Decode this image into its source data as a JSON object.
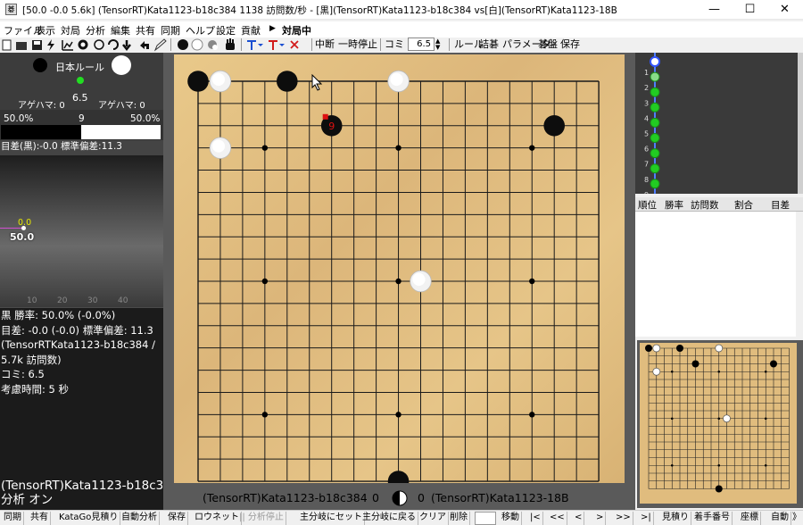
{
  "window": {
    "title": "[50.0 -0.0 5.6k] (TensorRT)Kata1123-b18c384 1138 訪問数/秒 - [黒](TensorRT)Kata1123-b18c384 vs[白](TensorRT)Kata1123-18B",
    "minimize": "—",
    "maximize": "☐",
    "close": "✕"
  },
  "menu": [
    "ファイル",
    "表示",
    "対局",
    "分析",
    "編集",
    "共有",
    "同期",
    "ヘルプ",
    "設定",
    "貢献",
    "▶",
    "対局中"
  ],
  "toolbar": {
    "pause_label": "中断",
    "stop_label": "一時停止",
    "komi_label": "コミ",
    "komi_value": "6.5",
    "rule_label": "ルール",
    "tsume_label": "詰碁",
    "param_label": "パラメータ",
    "board_label": "碁盤",
    "save_label": "保存"
  },
  "left": {
    "rule_text": "日本ルール",
    "komi": "6.5",
    "black_captures": "アゲハマ: 0",
    "white_captures": "アゲハマ: 0",
    "black_winrate_pct": "50.0%",
    "move_number": "9",
    "white_winrate_pct": "50.0%",
    "black_winrate_frac": 0.5,
    "score_line": "目差(黒):-0.0 標準偏差:11.3",
    "graph_point_label": "0.0",
    "graph_value_label": "50.0",
    "graph_ticks": [
      "10",
      "20",
      "30",
      "40"
    ],
    "info_lines": [
      "黒 勝率: 50.0% (-0.0%)",
      "目差: -0.0 (-0.0) 標準偏差: 11.3",
      "(TensorRTKata1123-b18c384 /",
      "5.7k 訪問数)",
      "コミ: 6.5",
      "考慮時間: 5 秒"
    ],
    "engine_name": "(TensorRT)Kata1123-b18c3",
    "analysis_state": "分析 オン"
  },
  "board": {
    "size": 19,
    "black_stones": [
      [
        0,
        0
      ],
      [
        4,
        0
      ],
      [
        16,
        2
      ],
      [
        9,
        18
      ],
      [
        6,
        2
      ]
    ],
    "white_stones": [
      [
        1,
        0
      ],
      [
        9,
        0
      ],
      [
        1,
        3
      ],
      [
        10,
        9
      ]
    ],
    "last_move": [
      6,
      2
    ],
    "last_move_number": "9",
    "star_points": [
      [
        3,
        3
      ],
      [
        9,
        3
      ],
      [
        15,
        3
      ],
      [
        3,
        9
      ],
      [
        9,
        9
      ],
      [
        15,
        9
      ],
      [
        3,
        15
      ],
      [
        9,
        15
      ],
      [
        15,
        15
      ]
    ],
    "black_player": "(TensorRT)Kata1123-b18c384",
    "black_captures": "0",
    "white_captures": "0",
    "white_player": "(TensorRT)Kata1123-18B"
  },
  "tree": {
    "move_numbers": [
      "1",
      "2",
      "3",
      "4",
      "5",
      "6",
      "7",
      "8",
      "9"
    ]
  },
  "candidates": {
    "headers": [
      "順位",
      "勝率",
      "訪問数",
      "割合",
      "目差"
    ]
  },
  "statusbar": [
    "同期",
    "共有",
    "KataGo見積り",
    "自動分析",
    "保存",
    "ロウネット",
    "|| 分析停止",
    "主分岐にセット",
    "主分岐に戻る",
    "クリア",
    "削除",
    "",
    "移動",
    "|<",
    "<<",
    "<",
    ">",
    ">>",
    ">|",
    "見積り",
    "着手番号",
    "座標",
    "自動",
    "》"
  ],
  "colors": {
    "board": "#e0bc7e",
    "panel_dark": "#4a4a4a",
    "green_node": "#22cc22",
    "last_move_marker": "#dd1111"
  }
}
